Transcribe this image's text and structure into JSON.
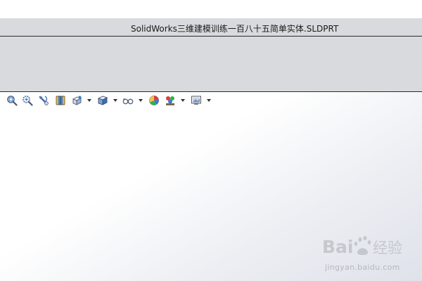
{
  "window": {
    "title": "SolidWorks三维建模训练一百八十五简单实体.SLDPRT"
  },
  "toolbar": {
    "buttons": [
      {
        "icon": "zoom-to-fit-icon",
        "has_dropdown": false
      },
      {
        "icon": "zoom-to-area-icon",
        "has_dropdown": false
      },
      {
        "icon": "previous-view-icon",
        "has_dropdown": false
      },
      {
        "icon": "section-view-icon",
        "has_dropdown": false
      },
      {
        "icon": "view-orientation-icon",
        "has_dropdown": true
      },
      {
        "icon": "display-style-icon",
        "has_dropdown": true
      },
      {
        "icon": "hide-show-items-icon",
        "has_dropdown": true
      },
      {
        "icon": "edit-appearance-icon",
        "has_dropdown": false
      },
      {
        "icon": "apply-scene-icon",
        "has_dropdown": true
      },
      {
        "icon": "view-settings-icon",
        "has_dropdown": true
      }
    ]
  },
  "watermark": {
    "logo_text": "Bai经验",
    "url": "jingyan.baidu.com"
  },
  "colors": {
    "chrome": "#d8dadd",
    "viewport_top": "#ffffff",
    "viewport_bottom": "#dfe2ea",
    "watermark": "#b4b7bd"
  }
}
